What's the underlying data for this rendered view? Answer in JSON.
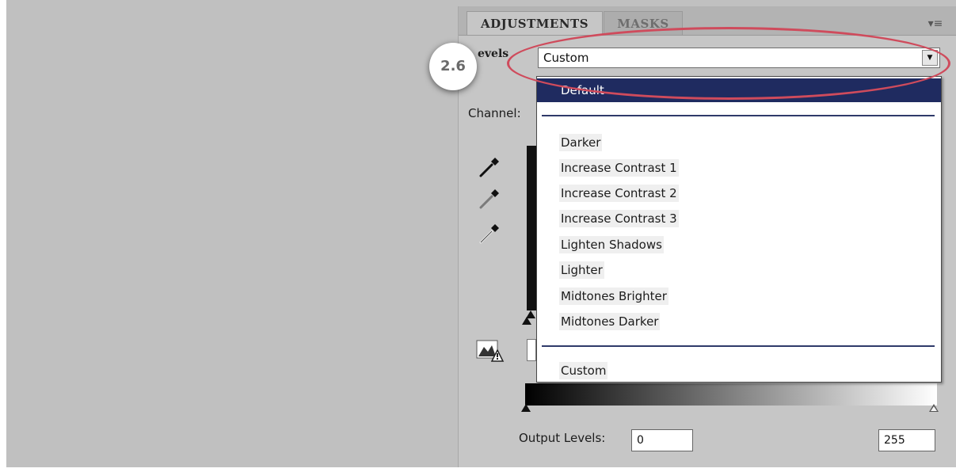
{
  "tabs": {
    "adjustments": "ADJUSTMENTS",
    "masks": "MASKS",
    "menu_icon": "panel-menu-icon"
  },
  "levels": {
    "label": "evels",
    "preset_value": "Custom"
  },
  "badge": "2.6",
  "channel_label": "Channel:",
  "dropdown": {
    "items": [
      "Default",
      "Darker",
      "Increase Contrast 1",
      "Increase Contrast 2",
      "Increase Contrast 3",
      "Lighten Shadows",
      "Lighter",
      "Midtones Brighter",
      "Midtones Darker",
      "Custom"
    ],
    "selected": "Default"
  },
  "output": {
    "label": "Output Levels:",
    "min": "0",
    "max": "255"
  },
  "colors": {
    "highlight_ellipse": "#cf4b5c",
    "selected_item": "#1f2b60",
    "panel": "#c6c6c6"
  }
}
